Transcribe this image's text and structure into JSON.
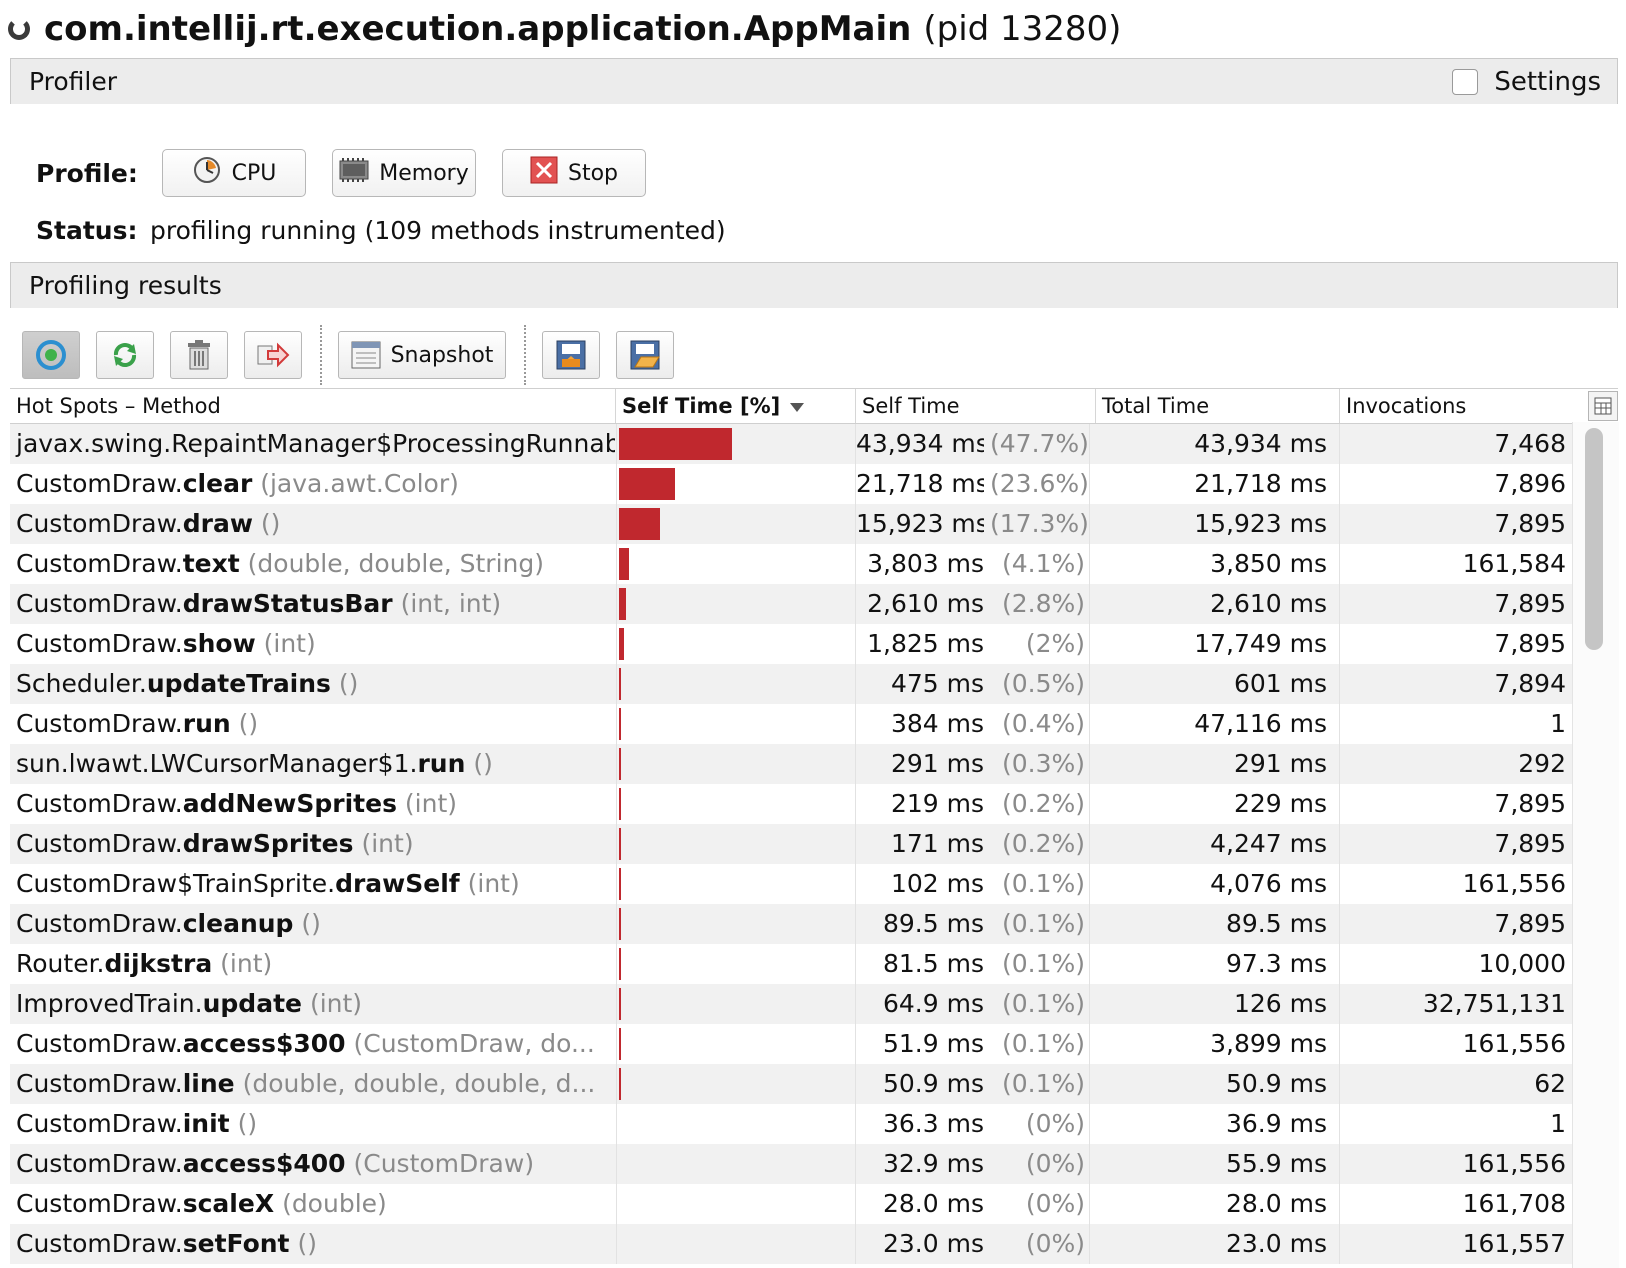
{
  "title": {
    "app": "com.intellij.rt.execution.application.AppMain",
    "pid": "(pid 13280)"
  },
  "profiler_section": {
    "title": "Profiler",
    "settings_label": "Settings"
  },
  "profile": {
    "label": "Profile:",
    "buttons": {
      "cpu": "CPU",
      "memory": "Memory",
      "stop": "Stop"
    }
  },
  "status": {
    "label": "Status:",
    "text": "profiling running (109 methods instrumented)"
  },
  "results_section": {
    "title": "Profiling results"
  },
  "toolbar": {
    "snapshot_label": "Snapshot"
  },
  "table": {
    "columns": {
      "method": "Hot Spots – Method",
      "self_pct": "Self Time [%]",
      "self_time": "Self Time",
      "total_time": "Total Time",
      "invocations": "Invocations"
    },
    "sorted_by": "Self Time [%]",
    "rows": [
      {
        "cls": "javax.swing.RepaintManager$ProcessingRunnab",
        "name": "",
        "sig": "",
        "self_time": "43,934 ms",
        "self_pct": "(47.7%)",
        "total_time": "43,934 ms",
        "invocations": "7,468",
        "bar": 47.7
      },
      {
        "cls": "CustomDraw.",
        "name": "clear",
        "sig": "(java.awt.Color)",
        "self_time": "21,718 ms",
        "self_pct": "(23.6%)",
        "total_time": "21,718 ms",
        "invocations": "7,896",
        "bar": 23.6
      },
      {
        "cls": "CustomDraw.",
        "name": "draw",
        "sig": "()",
        "self_time": "15,923 ms",
        "self_pct": "(17.3%)",
        "total_time": "15,923 ms",
        "invocations": "7,895",
        "bar": 17.3
      },
      {
        "cls": "CustomDraw.",
        "name": "text",
        "sig": "(double, double, String)",
        "self_time": "3,803 ms",
        "self_pct": "(4.1%)",
        "total_time": "3,850 ms",
        "invocations": "161,584",
        "bar": 4.1
      },
      {
        "cls": "CustomDraw.",
        "name": "drawStatusBar",
        "sig": "(int, int)",
        "self_time": "2,610 ms",
        "self_pct": "(2.8%)",
        "total_time": "2,610 ms",
        "invocations": "7,895",
        "bar": 2.8
      },
      {
        "cls": "CustomDraw.",
        "name": "show",
        "sig": "(int)",
        "self_time": "1,825 ms",
        "self_pct": "(2%)",
        "total_time": "17,749 ms",
        "invocations": "7,895",
        "bar": 2.0
      },
      {
        "cls": "Scheduler.",
        "name": "updateTrains",
        "sig": "()",
        "self_time": "475 ms",
        "self_pct": "(0.5%)",
        "total_time": "601 ms",
        "invocations": "7,894",
        "bar": 0.5
      },
      {
        "cls": "CustomDraw.",
        "name": "run",
        "sig": "()",
        "self_time": "384 ms",
        "self_pct": "(0.4%)",
        "total_time": "47,116 ms",
        "invocations": "1",
        "bar": 0.4
      },
      {
        "cls": "sun.lwawt.LWCursorManager$1.",
        "name": "run",
        "sig": "()",
        "self_time": "291 ms",
        "self_pct": "(0.3%)",
        "total_time": "291 ms",
        "invocations": "292",
        "bar": 0.3
      },
      {
        "cls": "CustomDraw.",
        "name": "addNewSprites",
        "sig": "(int)",
        "self_time": "219 ms",
        "self_pct": "(0.2%)",
        "total_time": "229 ms",
        "invocations": "7,895",
        "bar": 0.2
      },
      {
        "cls": "CustomDraw.",
        "name": "drawSprites",
        "sig": "(int)",
        "self_time": "171 ms",
        "self_pct": "(0.2%)",
        "total_time": "4,247 ms",
        "invocations": "7,895",
        "bar": 0.2
      },
      {
        "cls": "CustomDraw$TrainSprite.",
        "name": "drawSelf",
        "sig": "(int)",
        "self_time": "102 ms",
        "self_pct": "(0.1%)",
        "total_time": "4,076 ms",
        "invocations": "161,556",
        "bar": 0.1
      },
      {
        "cls": "CustomDraw.",
        "name": "cleanup",
        "sig": "()",
        "self_time": "89.5 ms",
        "self_pct": "(0.1%)",
        "total_time": "89.5 ms",
        "invocations": "7,895",
        "bar": 0.1
      },
      {
        "cls": "Router.",
        "name": "dijkstra",
        "sig": "(int)",
        "self_time": "81.5 ms",
        "self_pct": "(0.1%)",
        "total_time": "97.3 ms",
        "invocations": "10,000",
        "bar": 0.1
      },
      {
        "cls": "ImprovedTrain.",
        "name": "update",
        "sig": "(int)",
        "self_time": "64.9 ms",
        "self_pct": "(0.1%)",
        "total_time": "126 ms",
        "invocations": "32,751,131",
        "bar": 0.1
      },
      {
        "cls": "CustomDraw.",
        "name": "access$300",
        "sig": "(CustomDraw, do...",
        "self_time": "51.9 ms",
        "self_pct": "(0.1%)",
        "total_time": "3,899 ms",
        "invocations": "161,556",
        "bar": 0.1
      },
      {
        "cls": "CustomDraw.",
        "name": "line",
        "sig": "(double, double, double, d...",
        "self_time": "50.9 ms",
        "self_pct": "(0.1%)",
        "total_time": "50.9 ms",
        "invocations": "62",
        "bar": 0.1
      },
      {
        "cls": "CustomDraw.",
        "name": "init",
        "sig": "()",
        "self_time": "36.3 ms",
        "self_pct": "(0%)",
        "total_time": "36.9 ms",
        "invocations": "1",
        "bar": 0
      },
      {
        "cls": "CustomDraw.",
        "name": "access$400",
        "sig": "(CustomDraw)",
        "self_time": "32.9 ms",
        "self_pct": "(0%)",
        "total_time": "55.9 ms",
        "invocations": "161,556",
        "bar": 0
      },
      {
        "cls": "CustomDraw.",
        "name": "scaleX",
        "sig": "(double)",
        "self_time": "28.0 ms",
        "self_pct": "(0%)",
        "total_time": "28.0 ms",
        "invocations": "161,708",
        "bar": 0
      },
      {
        "cls": "CustomDraw.",
        "name": "setFont",
        "sig": "()",
        "self_time": "23.0 ms",
        "self_pct": "(0%)",
        "total_time": "23.0 ms",
        "invocations": "161,557",
        "bar": 0
      }
    ]
  },
  "colors": {
    "bar": "#c0282e",
    "alt_row": "#f1f1f1"
  },
  "icons": [
    "spinner-icon",
    "cpu-clock-icon",
    "memory-chip-icon",
    "stop-icon",
    "live-results-icon",
    "refresh-icon",
    "trash-icon",
    "export-icon",
    "snapshot-icon",
    "save-icon",
    "open-icon",
    "column-chooser-icon"
  ]
}
